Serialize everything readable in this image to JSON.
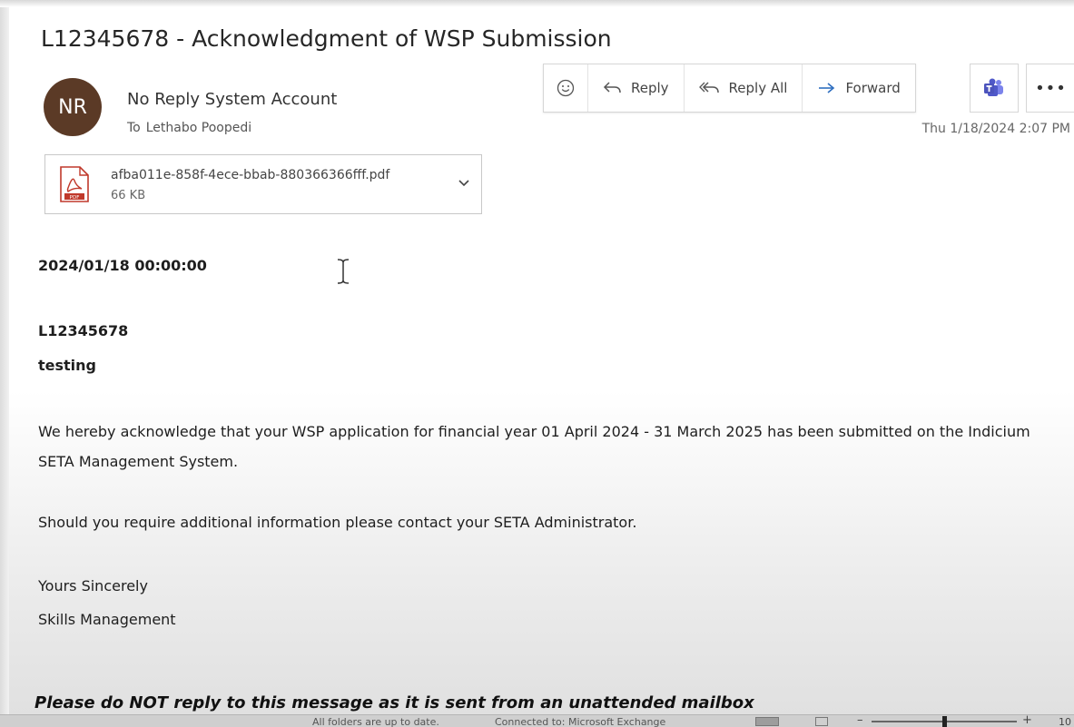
{
  "email": {
    "subject": "L12345678 - Acknowledgment of WSP Submission",
    "sender_initials": "NR",
    "sender_name": "No Reply System Account",
    "to_label": "To",
    "recipient": "Lethabo Poopedi",
    "timestamp": "Thu 1/18/2024 2:07 PM",
    "avatar_color": "#5b3a26"
  },
  "actions": {
    "reply": "Reply",
    "reply_all": "Reply All",
    "forward": "Forward",
    "more": "•••",
    "icons": [
      "emoji-icon",
      "reply-icon",
      "reply-all-icon",
      "forward-icon",
      "teams-icon",
      "more-icon"
    ]
  },
  "attachment": {
    "filename": "afba011e-858f-4ece-bbab-880366366fff.pdf",
    "size": "66 KB",
    "icon": "pdf-icon"
  },
  "body": {
    "date": "2024/01/18 00:00:00",
    "reference": "L12345678",
    "org_name": "testing",
    "paragraph1": "We hereby acknowledge that your WSP application for financial year 01 April 2024 - 31 March 2025 has been submitted on the Indicium SETA Management System.",
    "paragraph2": "Should you require additional information please contact your SETA Administrator.",
    "closing": "Yours Sincerely",
    "signature": "Skills Management",
    "notice": "Please do NOT reply to this message as it is sent from an unattended mailbox"
  },
  "status_bar": {
    "folders_status": "All folders are up to date.",
    "connection_status": "Connected to: Microsoft Exchange",
    "zoom_level": "10",
    "zoom_fraction": 0.5
  }
}
